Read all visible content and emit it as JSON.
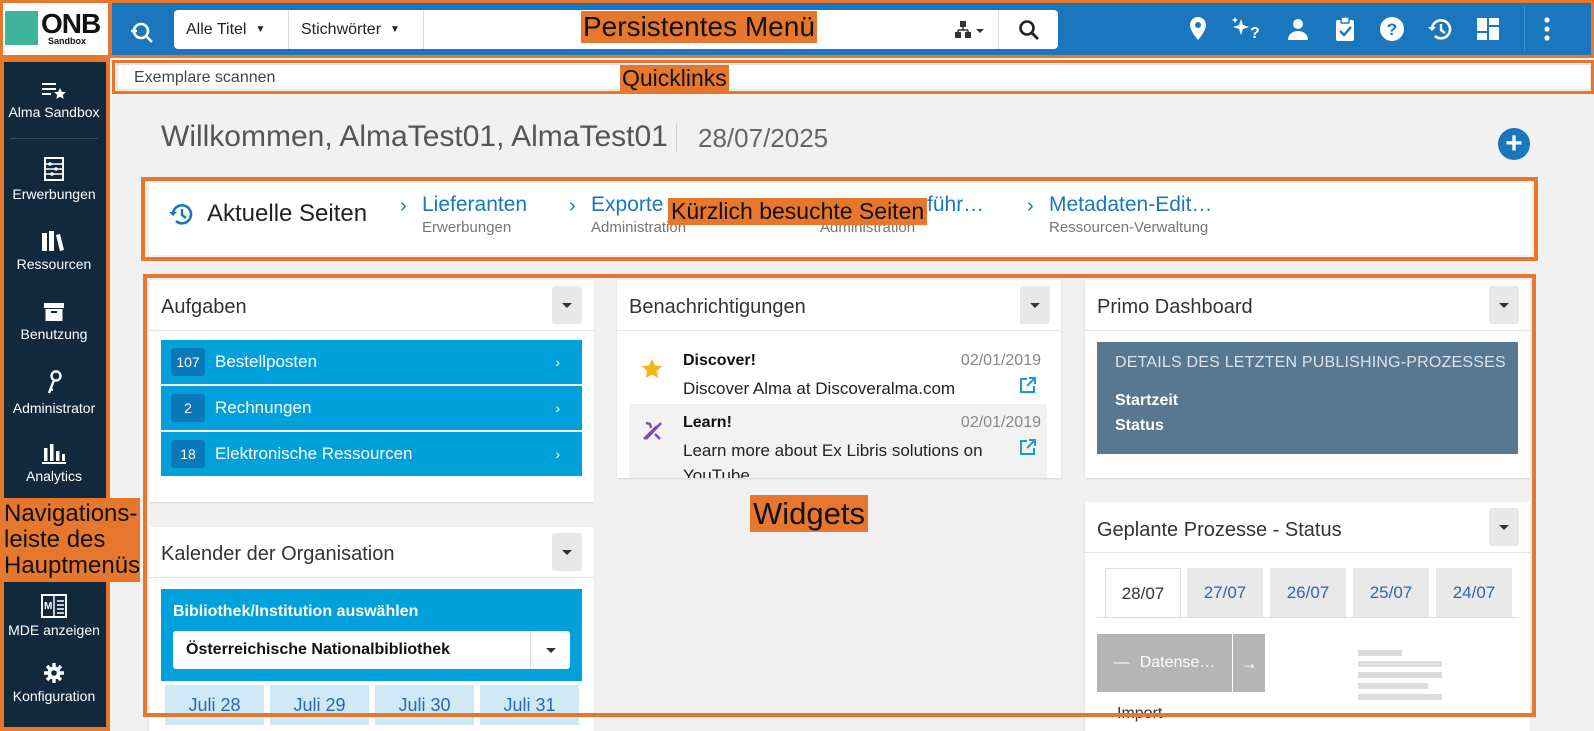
{
  "logo": {
    "text": "ONB",
    "sub": "Sandbox"
  },
  "search": {
    "scope": "Alle Titel",
    "field": "Stichwörter",
    "value": ""
  },
  "quicklinks": {
    "scan": "Exemplare scannen"
  },
  "sidebar": {
    "items": [
      {
        "label": "Alma Sandbox",
        "icon": "sandbox-icon"
      },
      {
        "label": "Erwerbungen",
        "icon": "abacus-icon"
      },
      {
        "label": "Ressourcen",
        "icon": "books-icon"
      },
      {
        "label": "Benutzung",
        "icon": "box-icon"
      },
      {
        "label": "Administrator",
        "icon": "key-icon"
      },
      {
        "label": "Analytics",
        "icon": "bar-chart-icon"
      },
      {
        "label": "MDE anzeigen",
        "icon": "metadata-editor-icon"
      },
      {
        "label": "Konfiguration",
        "icon": "gear-icon"
      }
    ]
  },
  "header": {
    "welcome": "Willkommen, AlmaTest01, AlmaTest01",
    "date": "28/07/2025",
    "add_symbol": "+"
  },
  "recent": {
    "title": "Aktuelle Seiten",
    "items": [
      {
        "label": "Lieferanten",
        "sub": "Erwerbungen"
      },
      {
        "label": "Exporte v",
        "sub": "Administration"
      },
      {
        "label": "führ…",
        "sub": "Administration"
      },
      {
        "label": "Metadaten-Edit…",
        "sub": "Ressourcen-Verwaltung"
      }
    ]
  },
  "tasks": {
    "title": "Aufgaben",
    "items": [
      {
        "count": "107",
        "label": "Bestellposten"
      },
      {
        "count": "2",
        "label": "Rechnungen"
      },
      {
        "count": "18",
        "label": "Elektronische Ressourcen"
      }
    ]
  },
  "notifications": {
    "title": "Benachrichtigungen",
    "items": [
      {
        "title": "Discover!",
        "body": "Discover Alma at Discoveralma.com",
        "date": "02/01/2019"
      },
      {
        "title": "Learn!",
        "body": "Learn more about Ex Libris solutions on YouTube",
        "date": "02/01/2019"
      }
    ]
  },
  "primo": {
    "title": "Primo Dashboard",
    "head": "DETAILS DES LETZTEN PUBLISHING-PROZESSES",
    "start": "Startzeit",
    "status": "Status"
  },
  "processes": {
    "title": "Geplante Prozesse - Status",
    "tabs": [
      "28/07",
      "27/07",
      "26/07",
      "25/07",
      "24/07"
    ],
    "group_label": "Datense…",
    "next_label": "Import"
  },
  "calendar": {
    "title": "Kalender der Organisation",
    "label": "Bibliothek/Institution auswählen",
    "selected": "Österreichische Nationalbibliothek",
    "days": [
      "Juli 28",
      "Juli 29",
      "Juli 30",
      "Juli 31"
    ]
  },
  "annotations": {
    "menu": "Persistentes Menü",
    "quicklinks": "Quicklinks",
    "recent": "Kürzlich besuchte Seiten",
    "widgets": "Widgets",
    "nav": "Navigations-\nleiste des\nHauptmenüs"
  },
  "colors": {
    "brand": "#1a77bd",
    "sidebar": "#12283d",
    "annotation": "#e8772e",
    "task": "#00a0da"
  }
}
